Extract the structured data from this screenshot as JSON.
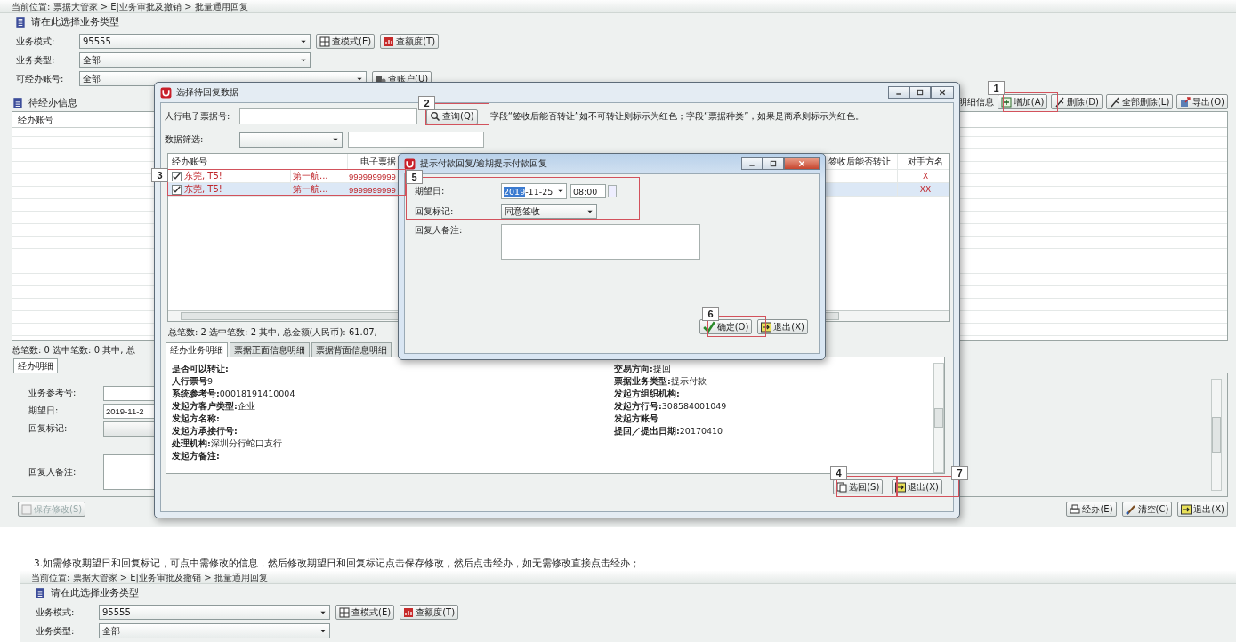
{
  "main_window": {
    "breadcrumb": "当前位置: 票据大管家 > E|业务审批及撤销 > 批量通用回复",
    "section_title": "请在此选择业务类型",
    "fields": [
      {
        "label": "业务模式:",
        "value": "95555",
        "buttons": [
          "查模式(E)",
          "查额度(T)"
        ]
      },
      {
        "label": "业务类型:",
        "value": "全部"
      },
      {
        "label": "可经办账号:",
        "value": "全部",
        "buttons": [
          "查账户(U)"
        ]
      }
    ],
    "pending_title": "待经办信息",
    "detail_label": "明细信息",
    "toolbar": [
      "增加(A)",
      "删除(D)",
      "全部删除(L)",
      "导出(O)"
    ],
    "list_columns": [
      "经办账号"
    ],
    "summary": "总笔数: 0 选中笔数: 0 其中, 总",
    "tabs": [
      {
        "label": "经办明细",
        "selected": true
      }
    ],
    "detail_fields": [
      {
        "label": "业务参考号:",
        "kind": "input"
      },
      {
        "label": "期望日:",
        "kind": "date",
        "value": "2019-11-2"
      },
      {
        "label": "回复标记:",
        "kind": "select"
      },
      {
        "label": "回复人备注:",
        "kind": "textarea"
      }
    ],
    "save_button": {
      "label": "保存修改(S)",
      "disabled": true
    },
    "actions": [
      "经办(E)",
      "清空(C)",
      "退出(X)"
    ]
  },
  "select_dialog": {
    "title": "选择待回复数据",
    "search_label": "人行电子票据号:",
    "search_button": "查询(Q)",
    "hint": "字段“签收后能否转让”如不可转让则标示为红色；字段“票据种类”，如果是商承则标示为红色。",
    "filter_label": "数据筛选:",
    "columns": [
      "经办账号",
      "电子票据",
      "签收后能否转让",
      "对手方名"
    ],
    "rows": [
      {
        "checked": true,
        "selected": false,
        "account": "东莞, T5!",
        "column_2": "第一航...",
        "bill_no": "9999999999",
        "counterparty": "X"
      },
      {
        "checked": true,
        "selected": true,
        "account": "东莞, T5!",
        "column_2": "第一航...",
        "bill_no": "9999999999",
        "counterparty": "XX"
      }
    ],
    "summary": "总笔数: 2  选中笔数: 2  其中, 总金额(人民币): 61.07,",
    "tabs": [
      {
        "label": "经办业务明细",
        "selected": true
      },
      {
        "label": "票据正面信息明细",
        "selected": false
      },
      {
        "label": "票据背面信息明细",
        "selected": false
      }
    ],
    "details_left": [
      {
        "label": "是否可以转让:"
      },
      {
        "label": "人行票号",
        "value": "9"
      },
      {
        "label": "系统参考号:",
        "value": "00018191410004"
      },
      {
        "label": "发起方客户类型:",
        "value": "企业"
      },
      {
        "label": "发起方名称:"
      },
      {
        "label": "发起方承接行号:"
      },
      {
        "label": "处理机构:",
        "value": "深圳分行蛇口支行"
      },
      {
        "label": "发起方备注:"
      }
    ],
    "details_right": [
      {
        "label": "交易方向:",
        "value": "提回"
      },
      {
        "label": "票据业务类型:",
        "value": "提示付款"
      },
      {
        "label": "发起方组织机构:"
      },
      {
        "label": "发起方行号:",
        "value": "308584001049"
      },
      {
        "label": "发起方账号"
      },
      {
        "label": "提回／提出日期:",
        "value": "20170410"
      }
    ],
    "buttons": [
      "选回(S)",
      "退出(X)"
    ]
  },
  "reply_dialog": {
    "title": "提示付款回复/逾期提示付款回复",
    "date_label": "期望日:",
    "date": "2019-11-25",
    "time": "08:00",
    "mark_label": "回复标记:",
    "mark": "同意签收",
    "remark_label": "回复人备注:",
    "buttons": [
      "确定(O)",
      "退出(X)"
    ]
  },
  "annotations": [
    "1",
    "2",
    "3",
    "4",
    "5",
    "6",
    "7"
  ],
  "caption": "3.如需修改期望日和回复标记，可点中需修改的信息，然后修改期望日和回复标记点击保存修改，然后点击经办，如无需修改直接点击经办；",
  "second_screen": {
    "breadcrumb": "当前位置: 票据大管家 > E|业务审批及撤销 > 批量通用回复",
    "section_title": "请在此选择业务类型",
    "fields": [
      {
        "label": "业务模式:",
        "value": "95555",
        "buttons": [
          "查模式(E)",
          "查额度(T)"
        ]
      },
      {
        "label": "业务类型:",
        "value": "全部"
      }
    ]
  }
}
